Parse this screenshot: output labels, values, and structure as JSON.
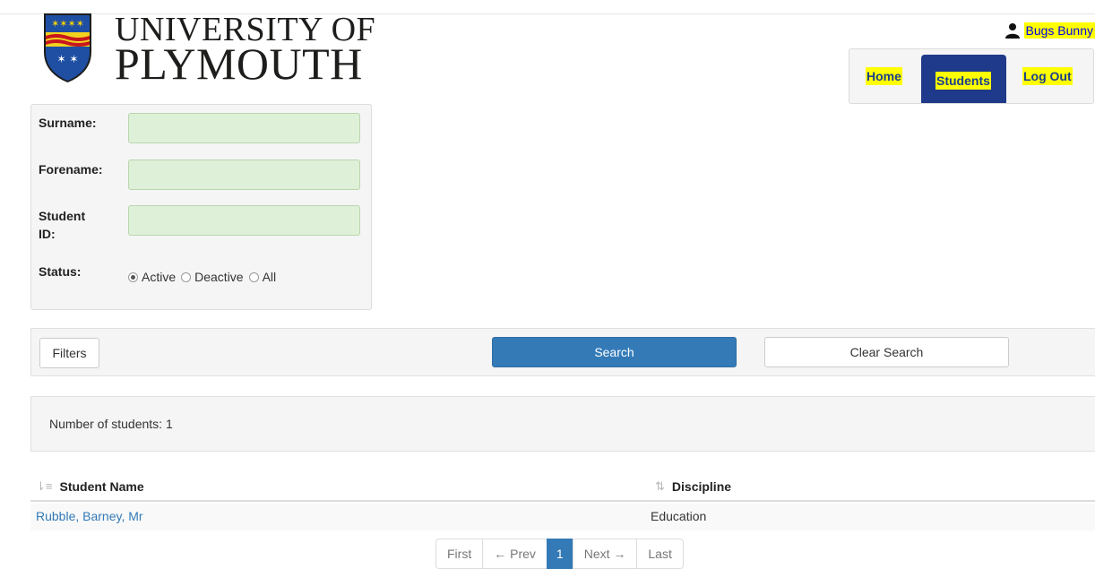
{
  "header": {
    "logo_line1": "UNIVERSITY OF",
    "logo_line2": "PLYMOUTH",
    "user_name": "Bugs Bunny"
  },
  "nav": {
    "items": [
      {
        "label": "Home",
        "active": false
      },
      {
        "label": "Students",
        "active": true
      },
      {
        "label": "Log Out",
        "active": false
      }
    ]
  },
  "filters": {
    "surname_label": "Surname:",
    "surname_value": "",
    "forename_label": "Forename:",
    "forename_value": "",
    "student_id_label_1": "Student",
    "student_id_label_2": "ID:",
    "student_id_value": "",
    "status_label": "Status:",
    "status_options": [
      "Active",
      "Deactive",
      "All"
    ],
    "status_selected": "Active"
  },
  "actions": {
    "filters_label": "Filters",
    "search_label": "Search",
    "clear_label": "Clear Search"
  },
  "results": {
    "count_text": "Number of students: 1",
    "columns": [
      "Student Name",
      "Discipline"
    ],
    "rows": [
      {
        "name": "Rubble, Barney, Mr",
        "discipline": "Education"
      }
    ]
  },
  "pagination": {
    "first": "First",
    "prev": "← Prev",
    "current": "1",
    "next": "Next →",
    "last": "Last"
  },
  "colors": {
    "primary": "#337ab7",
    "nav_active": "#1f3a8a",
    "input_bg": "#dff0d8",
    "highlight": "#ffff00"
  }
}
